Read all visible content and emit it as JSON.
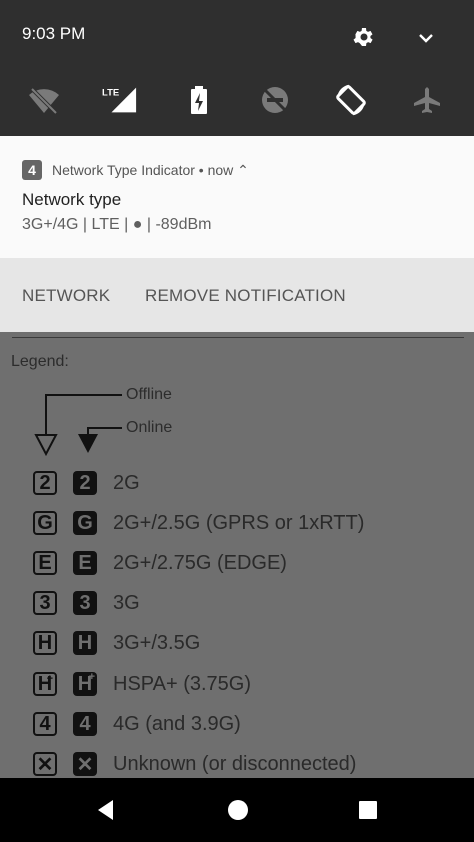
{
  "status": {
    "time": "9:03 PM"
  },
  "quick_tiles": [
    {
      "icon": "wifi-off-icon"
    },
    {
      "icon": "lte-signal-icon",
      "label": "LTE"
    },
    {
      "icon": "battery-charging-icon"
    },
    {
      "icon": "do-not-disturb-off-icon"
    },
    {
      "icon": "auto-rotate-icon"
    },
    {
      "icon": "airplane-mode-icon"
    }
  ],
  "notification": {
    "badge": "4",
    "app_line": "Network Type Indicator • now ⌃",
    "title": "Network type",
    "text": "3G+/4G  |  LTE  |  ●  |  -89dBm",
    "actions": [
      "NETWORK",
      "REMOVE NOTIFICATION"
    ]
  },
  "legend": {
    "title": "Legend:",
    "offline": "Offline",
    "online": "Online",
    "rows": [
      {
        "glyph": "2",
        "label": "2G"
      },
      {
        "glyph": "G",
        "label": "2G+/2.5G (GPRS or 1xRTT)"
      },
      {
        "glyph": "E",
        "label": "2G+/2.75G (EDGE)"
      },
      {
        "glyph": "3",
        "label": "3G"
      },
      {
        "glyph": "H",
        "label": "3G+/3.5G"
      },
      {
        "glyph": "H",
        "sup": "+",
        "label": "HSPA+ (3.75G)"
      },
      {
        "glyph": "4",
        "label": "4G (and 3.9G)"
      },
      {
        "glyph": "✕",
        "label": "Unknown (or disconnected)"
      }
    ]
  },
  "colors": {
    "statusbar": "#2f2f2f",
    "legend_bg": "#6f6f6f",
    "glyph": "#111111"
  }
}
